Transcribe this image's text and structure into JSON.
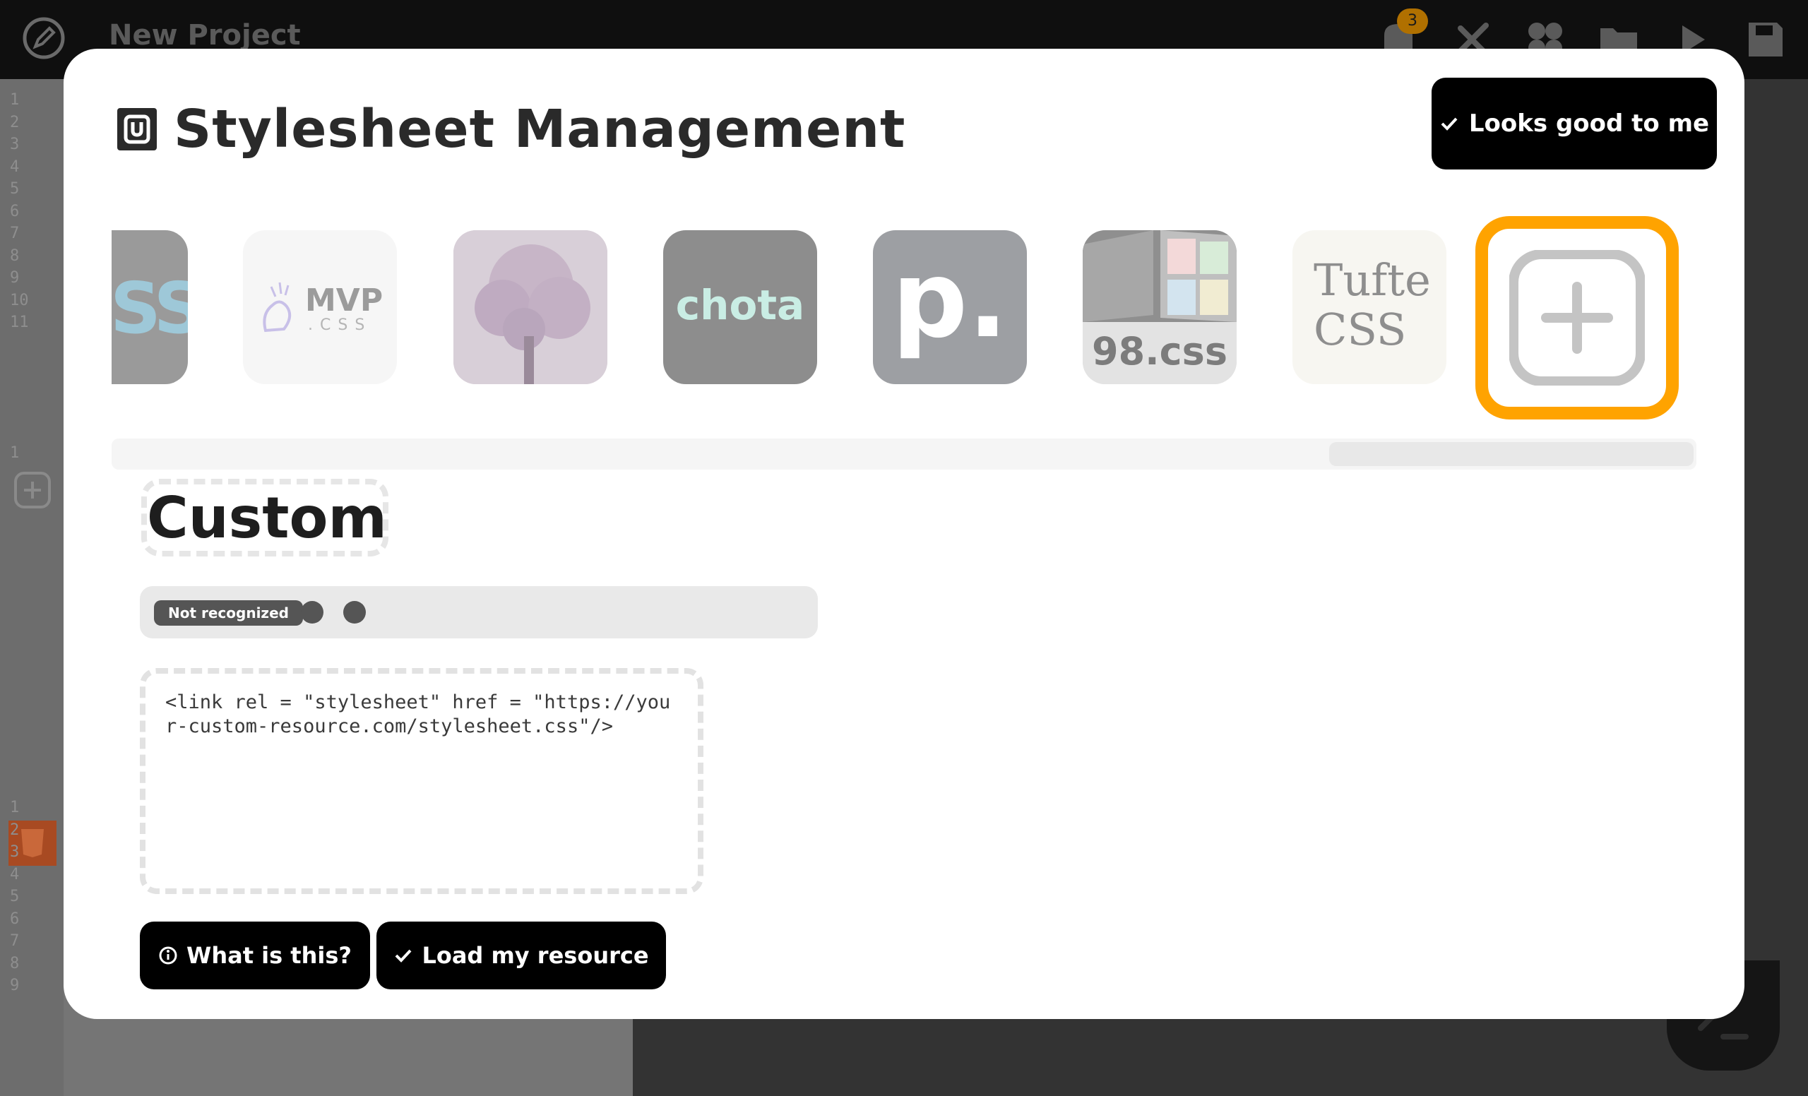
{
  "app": {
    "project_title": "New Project",
    "notification_count": "3",
    "top_icons": [
      "notification-icon",
      "tools-icon",
      "plugins-icon",
      "folder-icon",
      "run-icon",
      "save-icon"
    ]
  },
  "editor": {
    "gutter_top": [
      "1",
      "2",
      "3",
      "4",
      "5",
      "6",
      "7",
      "8",
      "9",
      "10",
      "11"
    ],
    "gutter_mid": [
      "1"
    ],
    "gutter_bottom": [
      "1",
      "2",
      "3",
      "4",
      "5",
      "6",
      "7",
      "8",
      "9"
    ]
  },
  "modal": {
    "title": "Stylesheet Management",
    "confirm_label": "Looks good to me",
    "tiles": {
      "partial_text": "SS",
      "mvp_text": "MVP",
      "mvp_sub": ".CSS",
      "chota_text": "chota",
      "p_text": "p.",
      "css98_text": "98.css",
      "tufte_line1": "Tufte",
      "tufte_line2": "CSS"
    },
    "custom": {
      "heading": "Custom",
      "status_label": "Not recognized",
      "code_value": "<link rel = \"stylesheet\" href = \"https://your-custom-resource.com/stylesheet.css\"/>",
      "what_label": "What is this?",
      "load_label": "Load my resource"
    }
  },
  "colors": {
    "accent": "#ffa300",
    "modal_bg": "#ffffff",
    "button_bg": "#000000",
    "overlay": "#3a3a3a"
  }
}
